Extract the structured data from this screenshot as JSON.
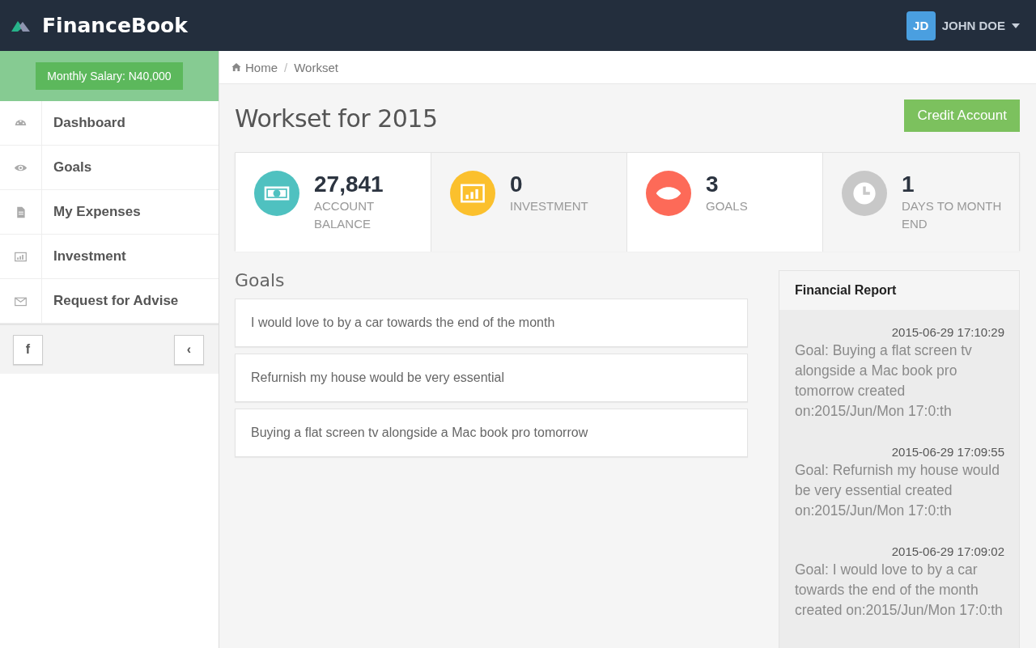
{
  "brand": {
    "name": "FinanceBook"
  },
  "user": {
    "initials": "JD",
    "name": "JOHN DOE"
  },
  "sidebar": {
    "salary": "Monthly Salary: N40,000",
    "items": [
      {
        "label": "Dashboard",
        "kind": "dashboard"
      },
      {
        "label": "Goals",
        "kind": "eye"
      },
      {
        "label": "My Expenses",
        "kind": "file"
      },
      {
        "label": "Investment",
        "kind": "chart"
      },
      {
        "label": "Request for Advise",
        "kind": "envelope"
      }
    ],
    "footer": {
      "facebook": "f",
      "collapse": "‹"
    }
  },
  "breadcrumb": {
    "separator": "/",
    "items": [
      {
        "label": "Home",
        "kind": "home"
      },
      {
        "label": "Workset",
        "kind": "page"
      }
    ]
  },
  "page": {
    "title": "Workset for 2015",
    "action": "Credit Account"
  },
  "stats": [
    {
      "value": "27,841",
      "label": "ACCOUNT BALANCE",
      "kind": "money",
      "color": "#4fc1c0"
    },
    {
      "value": "0",
      "label": "INVESTMENT",
      "kind": "chart",
      "color": "#fbc02d"
    },
    {
      "value": "3",
      "label": "GOALS",
      "kind": "eye",
      "color": "#fd6a58"
    },
    {
      "value": "1",
      "label": "DAYS TO MONTH END",
      "kind": "clock",
      "color": "#c8c8c8"
    }
  ],
  "goals": {
    "title": "Goals",
    "items": [
      "I would love to by a car towards the end of the month",
      "Refurnish my house would be very essential",
      "Buying a flat screen tv alongside a Mac book pro tomorrow"
    ]
  },
  "report": {
    "title": "Financial Report",
    "items": [
      {
        "time": "2015-06-29 17:10:29",
        "text": "Goal: Buying a flat screen tv alongside a Mac book pro tomorrow created on:2015/Jun/Mon 17:0:th"
      },
      {
        "time": "2015-06-29 17:09:55",
        "text": "Goal: Refurnish my house would be very essential created on:2015/Jun/Mon 17:0:th"
      },
      {
        "time": "2015-06-29 17:09:02",
        "text": "Goal: I would love to by a car towards the end of the month created on:2015/Jun/Mon 17:0:th"
      }
    ]
  }
}
